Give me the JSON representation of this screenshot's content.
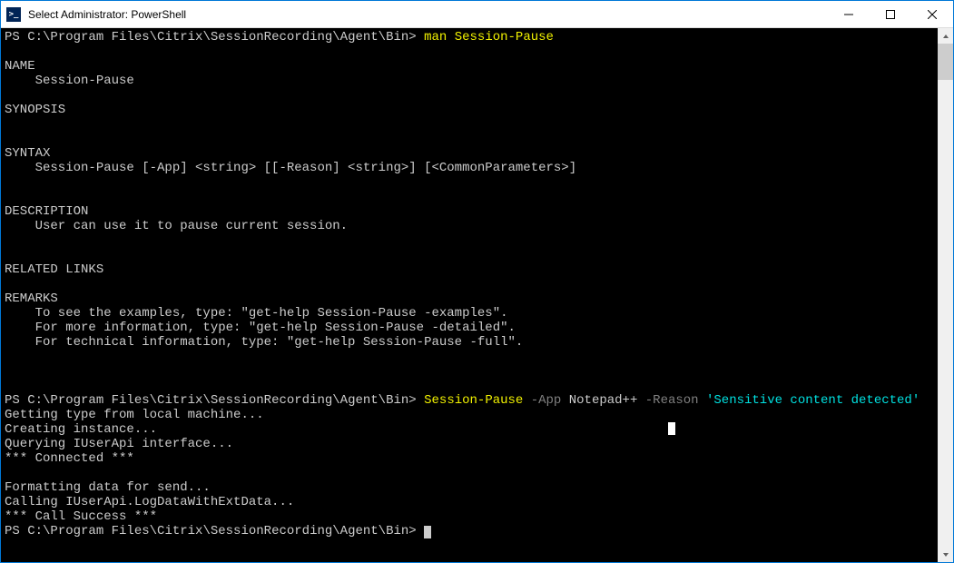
{
  "titlebar": {
    "icon_glyph": ">_",
    "title": "Select Administrator: PowerShell"
  },
  "prompt": {
    "prefix": "PS ",
    "path": "C:\\Program Files\\Citrix\\SessionRecording\\Agent\\Bin",
    "suffix": "> "
  },
  "block1": {
    "cmd": "man Session-Pause",
    "name_hdr": "NAME",
    "name_line": "    Session-Pause",
    "synopsis_hdr": "SYNOPSIS",
    "syntax_hdr": "SYNTAX",
    "syntax_line": "    Session-Pause [-App] <string> [[-Reason] <string>] [<CommonParameters>]",
    "desc_hdr": "DESCRIPTION",
    "desc_line": "    User can use it to pause current session.",
    "related_hdr": "RELATED LINKS",
    "remarks_hdr": "REMARKS",
    "remarks1": "    To see the examples, type: \"get-help Session-Pause -examples\".",
    "remarks2": "    For more information, type: \"get-help Session-Pause -detailed\".",
    "remarks3": "    For technical information, type: \"get-help Session-Pause -full\"."
  },
  "block2": {
    "cmd_name": "Session-Pause",
    "arg_app_flag": " -App ",
    "arg_app_val": "Notepad++",
    "arg_reason_flag": " -Reason ",
    "arg_reason_val": "'Sensitive content detected'",
    "out1": "Getting type from local machine...",
    "out2": "Creating instance...",
    "out3": "Querying IUserApi interface...",
    "out4": "*** Connected ***",
    "out5": "Formatting data for send...",
    "out6": "Calling IUserApi.LogDataWithExtData...",
    "out7": "*** Call Success ***"
  }
}
